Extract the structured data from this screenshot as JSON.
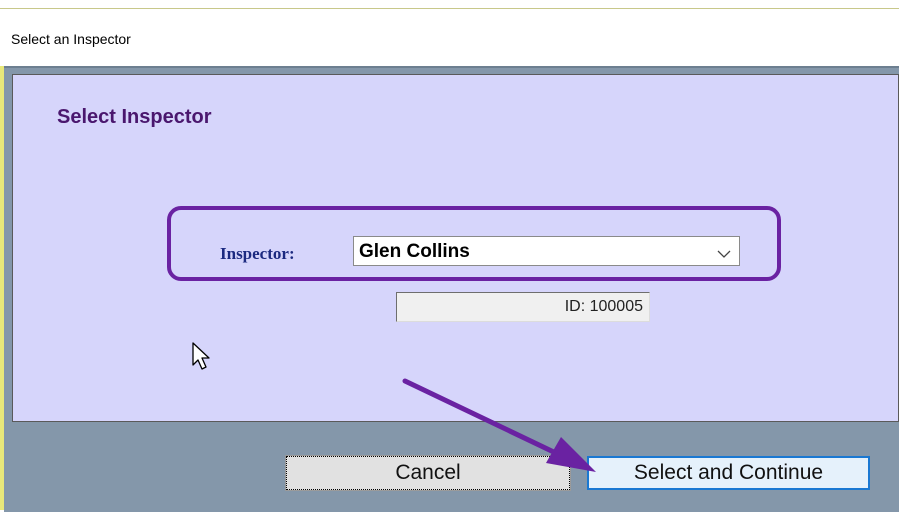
{
  "window": {
    "title": "Select an Inspector"
  },
  "panel": {
    "heading": "Select Inspector"
  },
  "inspector": {
    "label": "Inspector:",
    "selected_value": "Glen Collins",
    "id_text": "ID: 100005"
  },
  "buttons": {
    "cancel_label": "Cancel",
    "select_continue_label": "Select and Continue"
  },
  "colors": {
    "panel_bg": "#d6d5fb",
    "frame_bg": "#8497aa",
    "annotation_purple": "#6a22a2",
    "heading_purple": "#4a176e",
    "label_navy": "#1c2a80",
    "focus_blue": "#1a78d2"
  }
}
